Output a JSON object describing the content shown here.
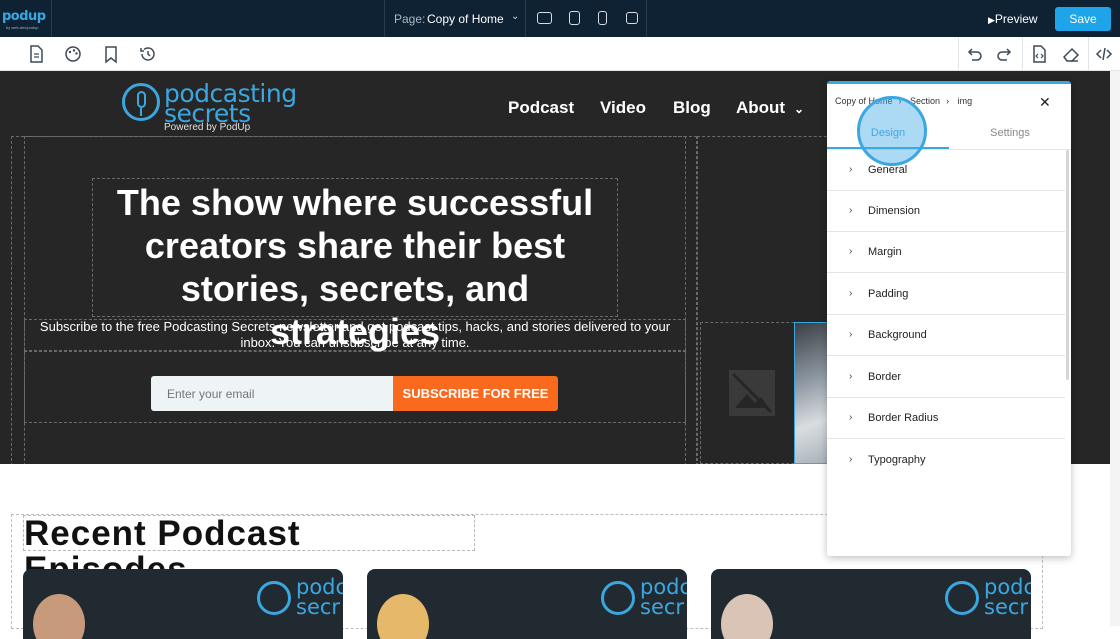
{
  "topbar": {
    "logo_text": "podup",
    "logo_sub": "by web.dev/podup",
    "page_label": "Page:",
    "page_value": "Copy of Home",
    "preview_label": "Preview",
    "save_label": "Save"
  },
  "hero": {
    "logo_line1": "podcasting",
    "logo_line2": "secrets",
    "logo_powered": "Powered by PodUp",
    "nav": [
      "Podcast",
      "Video",
      "Blog",
      "About"
    ],
    "headline": "The show where successful creators share their best stories, secrets, and strategies",
    "subtext": "Subscribe to the free Podcasting Secrets newsletter and get podcast tips, hacks, and stories delivered to your inbox. You can unsubscribe at any time.",
    "email_placeholder": "Enter your email",
    "subscribe_label": "SUBSCRIBE FOR FREE"
  },
  "recent": {
    "heading": "Recent Podcast Episodes",
    "card_brand_line1": "podc",
    "card_brand_line2": "secr"
  },
  "panel": {
    "breadcrumb": [
      "Copy of Home",
      "Section",
      "img"
    ],
    "tabs": [
      "Design",
      "Settings"
    ],
    "items": [
      "General",
      "Dimension",
      "Margin",
      "Padding",
      "Background",
      "Border",
      "Border Radius",
      "Typography"
    ]
  },
  "colors": {
    "accent": "#1ea5e9",
    "brand_blue": "#3ba7e0",
    "subscribe_orange": "#fa6a1e",
    "topbar_bg": "#0f2233",
    "hero_bg": "#262626"
  }
}
